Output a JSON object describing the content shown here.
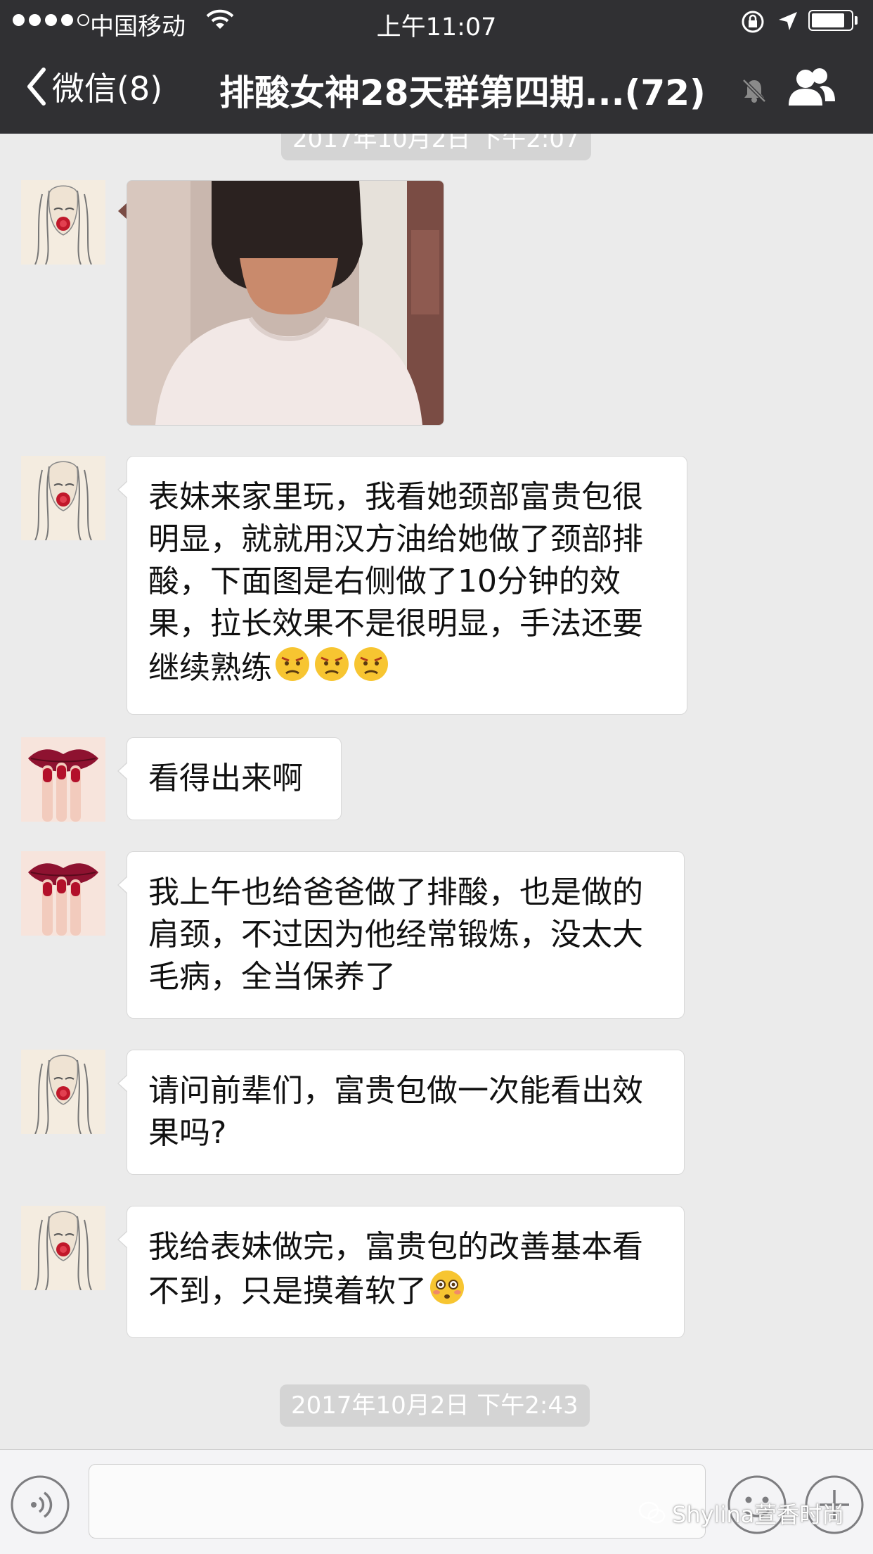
{
  "status_bar": {
    "carrier": "中国移动",
    "time": "上午11:07"
  },
  "nav": {
    "back_label": "微信(8)",
    "title": "排酸女神28天群第四期...(72)"
  },
  "messages": [
    {
      "type": "image",
      "avatar": "sketch-woman-avatar",
      "description_icon": "photo-neck-back"
    },
    {
      "type": "text",
      "avatar": "sketch-woman-avatar",
      "text": "表妹来家里玩，我看她颈部富贵包很明显，就就用汉方油给她做了颈部排酸，下面图是右侧做了10分钟的效果，拉长效果不是很明显，手法还要继续熟练",
      "emojis": [
        "frown-emoji",
        "frown-emoji",
        "frown-emoji"
      ]
    },
    {
      "type": "text",
      "avatar": "lips-nails-avatar",
      "text": "看得出来啊"
    },
    {
      "type": "text",
      "avatar": "lips-nails-avatar",
      "text": "我上午也给爸爸做了排酸，也是做的肩颈，不过因为他经常锻炼，没太大毛病，全当保养了"
    },
    {
      "type": "text",
      "avatar": "sketch-woman-avatar",
      "text": "请问前辈们，富贵包做一次能看出效果吗?"
    },
    {
      "type": "text",
      "avatar": "sketch-woman-avatar",
      "text": "我给表妹做完，富贵包的改善基本看不到，只是摸着软了",
      "emojis": [
        "flushed-emoji"
      ]
    }
  ],
  "timestamp_top": "2017年10月2日 下午2:07",
  "timestamp_bottom": "2017年10月2日 下午2:43",
  "watermark": "Shylina萱香时尚",
  "colors": {
    "nav_bg": "#303033",
    "chat_bg": "#ebebeb",
    "bubble_bg": "#ffffff",
    "timestamp_bg": "#d4d4d4"
  }
}
